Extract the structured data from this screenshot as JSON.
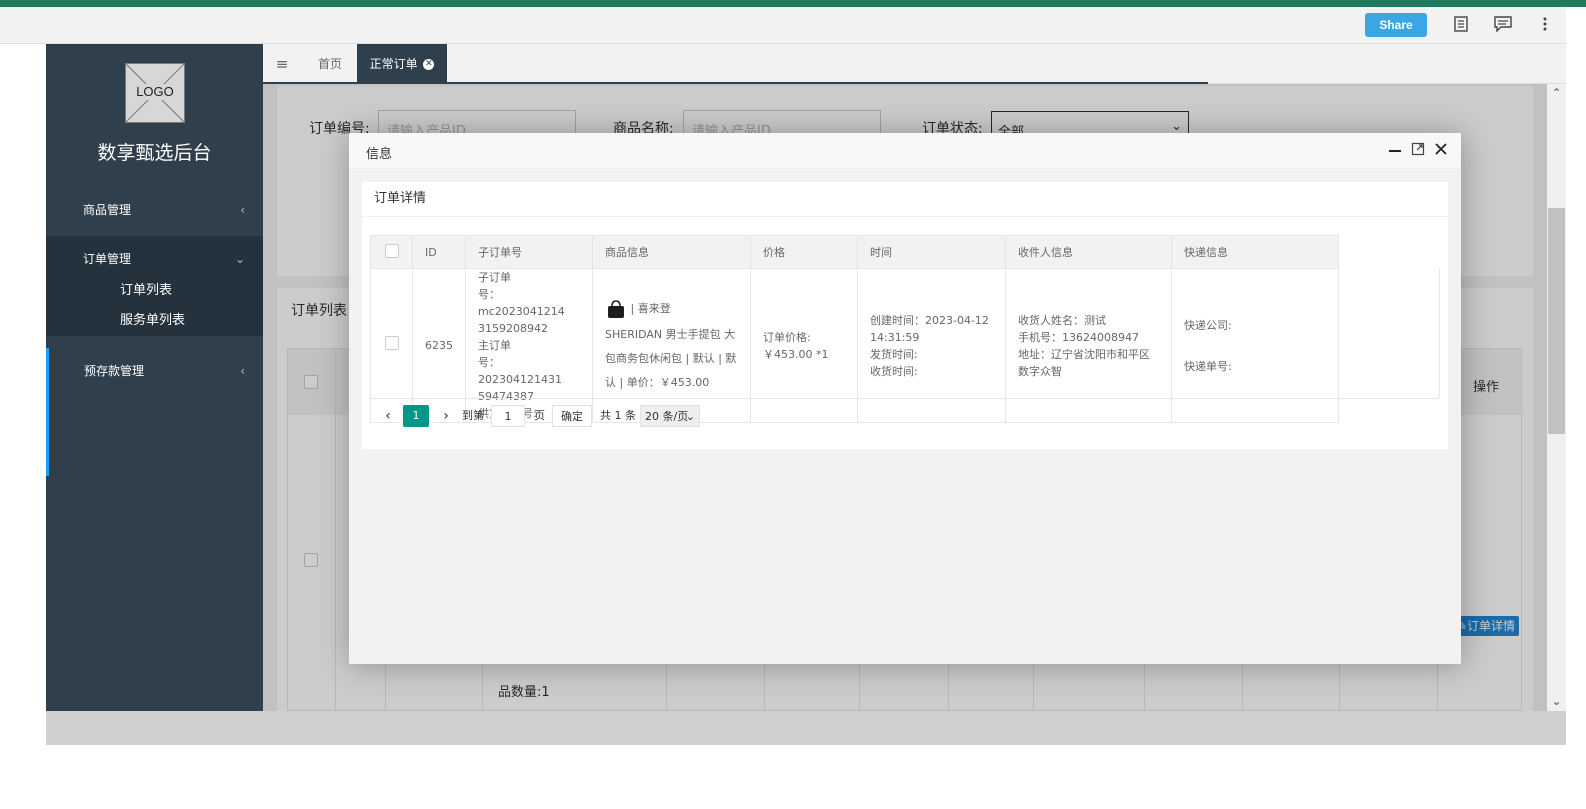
{
  "viewer": {
    "share_label": "Share",
    "icons": [
      "notes-icon",
      "comment-icon",
      "more-vertical-icon"
    ]
  },
  "sidebar": {
    "logo_text": "LOGO",
    "brand": "数享甄选后台",
    "menu": [
      {
        "label": "商品管理",
        "chevron": "‹"
      },
      {
        "label": "订单管理",
        "chevron": "⌄"
      },
      {
        "label": "预存款管理",
        "chevron": "‹"
      }
    ],
    "submenu": [
      "订单列表",
      "服务单列表"
    ]
  },
  "tabs": {
    "menu_icon": "≡",
    "home": "首页",
    "active": "正常订单"
  },
  "search": {
    "order_no_label": "订单编号:",
    "order_no_placeholder": "请输入产品ID",
    "product_name_label": "商品名称:",
    "product_name_placeholder": "请输入产品ID",
    "status_label": "订单状态:",
    "status_value": "全部"
  },
  "list": {
    "title": "订单列表",
    "action_header": "操作",
    "detail_button": "订单详情",
    "partial_text": "品数量:1"
  },
  "modal": {
    "title": "信息",
    "card_title": "订单详情",
    "columns": [
      "ID",
      "子订单号",
      "商品信息",
      "价格",
      "时间",
      "收件人信息",
      "快递信息"
    ],
    "row": {
      "id": "6235",
      "sub_order": [
        "子订单",
        "号：mc2023041214",
        "3159208942",
        "主订单",
        "号：202304121431",
        "59474387",
        "供货商单号:"
      ],
      "product_brand": "| 喜来登",
      "product_desc": [
        "SHERIDAN 男士手提包 大",
        "包商务包休闲包 | 默认 | 默",
        "认 | 单价：￥453.00"
      ],
      "price": [
        "订单价格:",
        "￥453.00 *1"
      ],
      "time": [
        "创建时间：2023-04-12",
        "14:31:59",
        "发货时间:",
        "收货时间:"
      ],
      "receiver": [
        "收货人姓名：测试",
        "手机号：13624008947",
        "地址：辽宁省沈阳市和平区",
        "数字众智"
      ],
      "express": [
        "快递公司:",
        "快递单号:"
      ]
    },
    "pager": {
      "current": "1",
      "goto_label": "到第",
      "goto_value": "1",
      "page_unit": "页",
      "confirm": "确定",
      "total": "共 1 条",
      "page_size": "20 条/页"
    }
  }
}
